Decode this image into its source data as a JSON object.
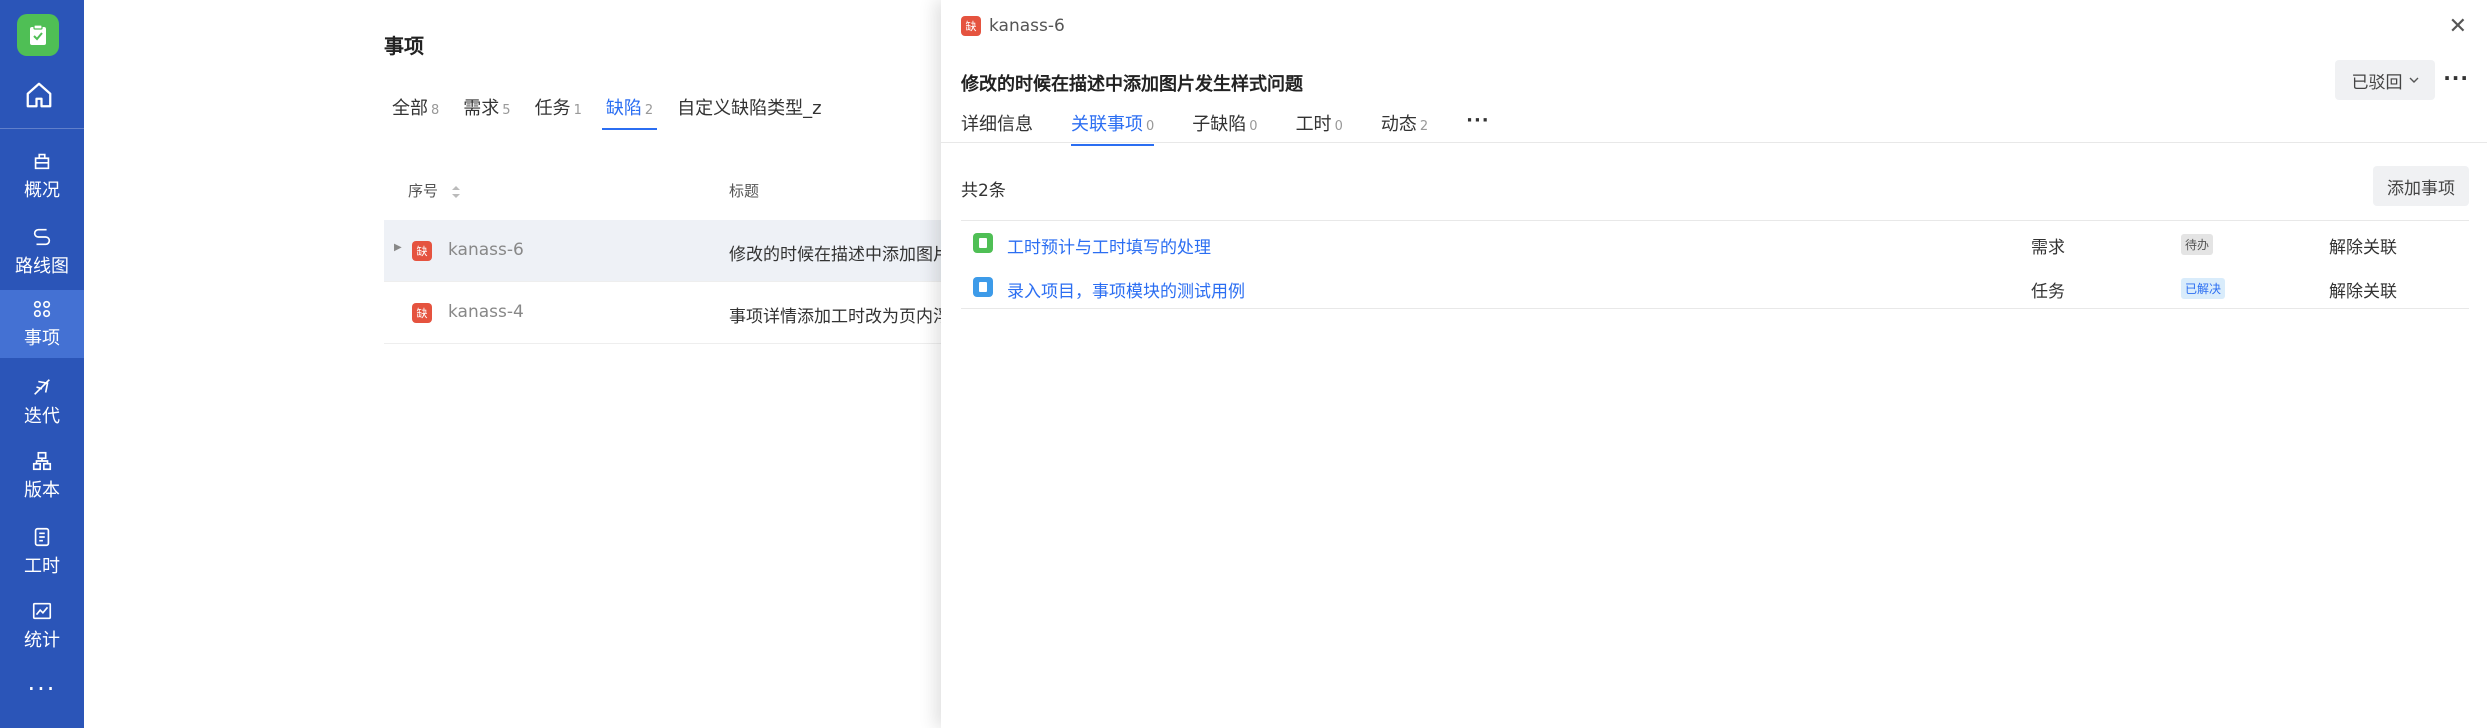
{
  "nav": {
    "items": [
      {
        "label": "概况",
        "icon": "overview-icon"
      },
      {
        "label": "路线图",
        "icon": "roadmap-icon"
      },
      {
        "label": "事项",
        "icon": "workitem-icon"
      },
      {
        "label": "迭代",
        "icon": "sprint-icon"
      },
      {
        "label": "版本",
        "icon": "version-icon"
      },
      {
        "label": "工时",
        "icon": "worklog-icon"
      },
      {
        "label": "统计",
        "icon": "statistics-icon"
      }
    ],
    "more": "···"
  },
  "list": {
    "title": "事项",
    "tabs": [
      {
        "label": "全部",
        "count": "8"
      },
      {
        "label": "需求",
        "count": "5"
      },
      {
        "label": "任务",
        "count": "1"
      },
      {
        "label": "缺陷",
        "count": "2"
      },
      {
        "label": "自定义缺陷类型_z",
        "count": ""
      }
    ],
    "col_key": "序号",
    "col_title": "标题",
    "rows": [
      {
        "key": "kanass-6",
        "title": "修改的时候在描述中添加图片发生样式问题"
      },
      {
        "key": "kanass-4",
        "title": "事项详情添加工时改为页内浮层、优化"
      }
    ]
  },
  "drawer": {
    "key": "kanass-6",
    "title": "修改的时候在描述中添加图片发生样式问题",
    "status": "已驳回",
    "tabs": [
      {
        "label": "详细信息",
        "count": ""
      },
      {
        "label": "关联事项",
        "count": "0"
      },
      {
        "label": "子缺陷",
        "count": "0"
      },
      {
        "label": "工时",
        "count": "0"
      },
      {
        "label": "动态",
        "count": "2"
      }
    ],
    "total": "共2条",
    "add_button": "添加事项",
    "relations": [
      {
        "name": "工时预计与工时填写的处理",
        "type": "需求",
        "status": "待办",
        "action": "解除关联",
        "color": "#4fbf55",
        "status_bg": "#e4e4e4"
      },
      {
        "name": "录入项目，事项模块的测试用例",
        "type": "任务",
        "status": "已解决",
        "action": "解除关联",
        "color": "#3d9be9",
        "status_bg": "#d9ecfb"
      }
    ]
  }
}
